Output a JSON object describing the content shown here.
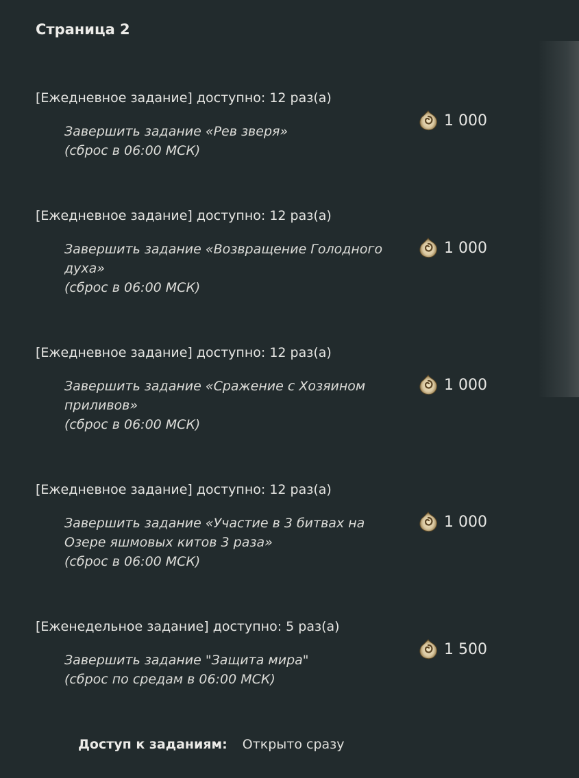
{
  "page_title": "Страница 2",
  "tasks": [
    {
      "header": "[Ежедневное задание] доступно: 12 раз(а)",
      "desc_lines": [
        "Завершить задание «Рев зверя»",
        "(сброс в 06:00 МСК)"
      ],
      "reward_icon": "spiral-coin-icon",
      "reward_amount": "1 000"
    },
    {
      "header": "[Ежедневное задание] доступно: 12 раз(а)",
      "desc_lines": [
        "Завершить задание «Возвращение Голодного",
        "духа»",
        "(сброс в 06:00 МСК)"
      ],
      "reward_icon": "spiral-coin-icon",
      "reward_amount": "1 000"
    },
    {
      "header": "[Ежедневное задание] доступно: 12 раз(а)",
      "desc_lines": [
        "Завершить задание «Сражение с Хозяином",
        "приливов»",
        "(сброс в 06:00 МСК)"
      ],
      "reward_icon": "spiral-coin-icon",
      "reward_amount": "1 000"
    },
    {
      "header": "[Ежедневное задание] доступно: 12 раз(а)",
      "desc_lines": [
        "Завершить задание «Участие в 3 битвах на",
        "Озере яшмовых китов 3 раза»",
        "(сброс в 06:00 МСК)"
      ],
      "reward_icon": "spiral-coin-icon",
      "reward_amount": "1 000"
    },
    {
      "header": "[Еженедельное задание] доступно: 5 раз(а)",
      "desc_lines": [
        "Завершить задание \"Защита мира\"",
        "(сброс по средам в 06:00 МСК)"
      ],
      "reward_icon": "spiral-coin-icon",
      "reward_amount": "1 500"
    }
  ],
  "footer": {
    "label": "Доступ к заданиям:",
    "value": "Открыто сразу"
  },
  "colors": {
    "background": "#222b2d",
    "text": "#e4e4e2",
    "icon_gold": "#d9c7a0"
  }
}
